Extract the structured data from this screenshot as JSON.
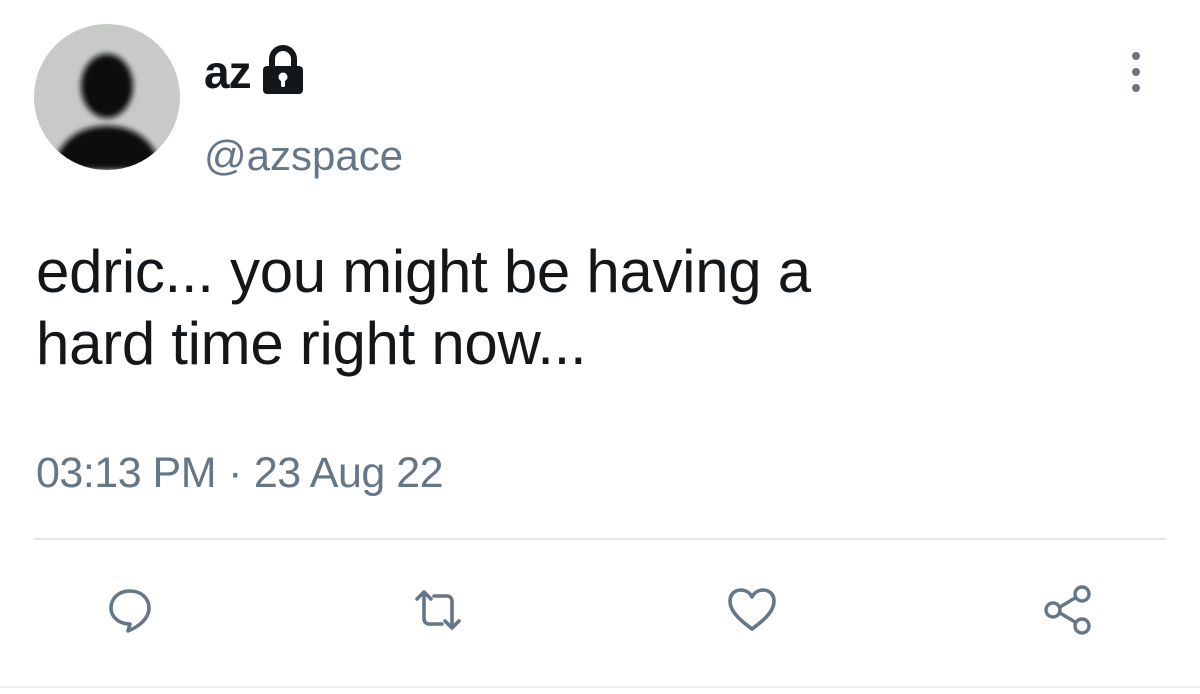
{
  "tweet": {
    "display_name": "az",
    "protected_icon": "lock-icon",
    "handle": "@azspace",
    "text_line1": "edric... you might be having a",
    "text_line2": "hard time right now...",
    "time": "03:13 PM",
    "separator": "·",
    "date": "23 Aug 22"
  },
  "actions": {
    "reply_icon": "reply-icon",
    "retweet_icon": "retweet-icon",
    "like_icon": "heart-icon",
    "share_icon": "share-icon",
    "more_icon": "more-vertical-icon"
  },
  "colors": {
    "text": "#14171a",
    "secondary": "#657786",
    "divider": "#e1e8ed",
    "avatar_bg": "#c7cac7"
  }
}
